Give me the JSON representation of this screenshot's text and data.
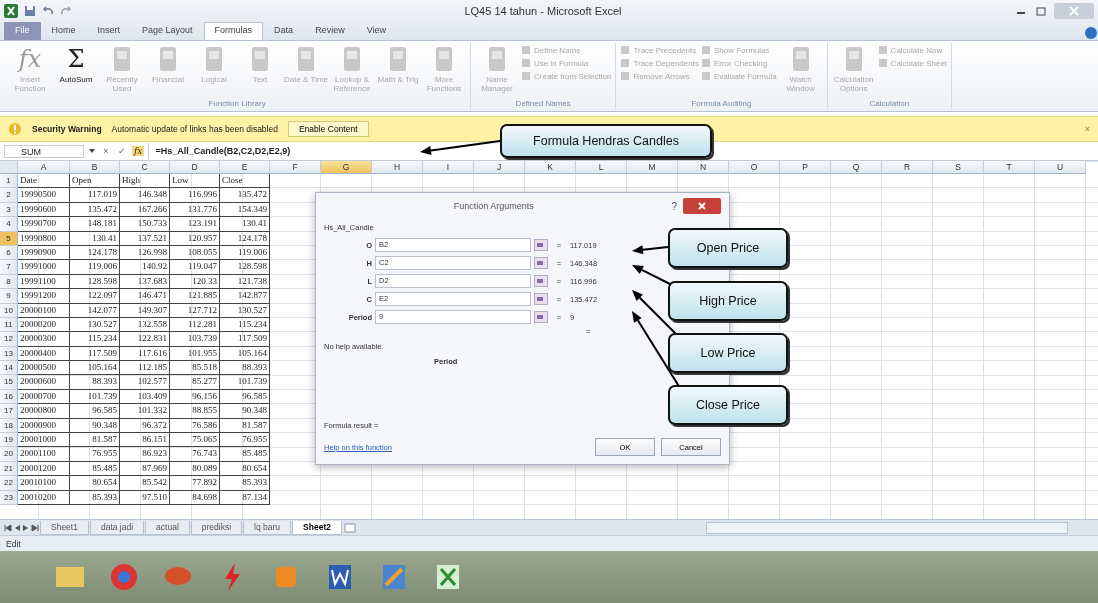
{
  "window": {
    "title": "LQ45 14 tahun - Microsoft Excel"
  },
  "ribbon_tabs": [
    {
      "label": "File",
      "selected": false,
      "kind": "file"
    },
    {
      "label": "Home",
      "selected": false,
      "kind": "tab"
    },
    {
      "label": "Insert",
      "selected": false,
      "kind": "tab"
    },
    {
      "label": "Page Layout",
      "selected": false,
      "kind": "tab"
    },
    {
      "label": "Formulas",
      "selected": true,
      "kind": "tab"
    },
    {
      "label": "Data",
      "selected": false,
      "kind": "tab"
    },
    {
      "label": "Review",
      "selected": false,
      "kind": "tab"
    },
    {
      "label": "View",
      "selected": false,
      "kind": "tab"
    }
  ],
  "ribbon_groups": [
    {
      "label": "Function Library",
      "buttons": [
        {
          "kind": "glyph",
          "glyph": "fx",
          "label": "Insert Function",
          "disabled": true
        },
        {
          "kind": "glyph",
          "glyph": "Σ",
          "label": "AutoSum",
          "disabled": false
        },
        {
          "kind": "large",
          "label": "Recently Used",
          "disabled": true
        },
        {
          "kind": "large",
          "label": "Financial",
          "disabled": true
        },
        {
          "kind": "large",
          "label": "Logical",
          "disabled": true
        },
        {
          "kind": "large",
          "label": "Text",
          "disabled": true
        },
        {
          "kind": "large",
          "label": "Date & Time",
          "disabled": true
        },
        {
          "kind": "large",
          "label": "Lookup & Reference",
          "disabled": true
        },
        {
          "kind": "large",
          "label": "Math & Trig",
          "disabled": true
        },
        {
          "kind": "large",
          "label": "More Functions",
          "disabled": true
        }
      ]
    },
    {
      "label": "Defined Names",
      "buttons": [
        {
          "kind": "large",
          "label": "Name Manager",
          "disabled": true
        },
        {
          "kind": "small",
          "label": "Define Name",
          "disabled": true
        },
        {
          "kind": "small",
          "label": "Use in Formula",
          "disabled": true
        },
        {
          "kind": "small",
          "label": "Create from Selection",
          "disabled": true
        }
      ]
    },
    {
      "label": "Formula Auditing",
      "buttons": [
        {
          "kind": "small",
          "label": "Trace Precedents",
          "disabled": true
        },
        {
          "kind": "small",
          "label": "Trace Dependents",
          "disabled": true
        },
        {
          "kind": "small",
          "label": "Remove Arrows",
          "disabled": true
        },
        {
          "kind": "small",
          "label": "Show Formulas",
          "disabled": true
        },
        {
          "kind": "small",
          "label": "Error Checking",
          "disabled": true
        },
        {
          "kind": "small",
          "label": "Evaluate Formula",
          "disabled": true
        },
        {
          "kind": "large",
          "label": "Watch Window",
          "disabled": true
        }
      ]
    },
    {
      "label": "Calculation",
      "buttons": [
        {
          "kind": "large",
          "label": "Calculation Options",
          "disabled": true
        },
        {
          "kind": "small",
          "label": "Calculate Now",
          "disabled": true
        },
        {
          "kind": "small",
          "label": "Calculate Sheet",
          "disabled": true
        }
      ]
    }
  ],
  "message_bar": {
    "title": "Security Warning",
    "message": "Automatic update of links has been disabled",
    "button": "Enable Content",
    "close": "×"
  },
  "formula_bar": {
    "name_box": "SUM",
    "cancel": "×",
    "enter": "✓",
    "function": "fx",
    "formula": "=Hs_All_Candle(B2,C2,D2,E2,9)"
  },
  "columns": [
    {
      "label": "A",
      "selected": false
    },
    {
      "label": "B",
      "selected": false
    },
    {
      "label": "C",
      "selected": false
    },
    {
      "label": "D",
      "selected": false
    },
    {
      "label": "E",
      "selected": false
    },
    {
      "label": "F",
      "selected": false
    },
    {
      "label": "G",
      "selected": true
    },
    {
      "label": "H",
      "selected": false
    },
    {
      "label": "I",
      "selected": false
    },
    {
      "label": "J",
      "selected": false
    },
    {
      "label": "K",
      "selected": false
    },
    {
      "label": "L",
      "selected": false
    },
    {
      "label": "M",
      "selected": false
    },
    {
      "label": "N",
      "selected": false
    },
    {
      "label": "O",
      "selected": false
    },
    {
      "label": "P",
      "selected": false
    },
    {
      "label": "Q",
      "selected": false
    },
    {
      "label": "R",
      "selected": false
    },
    {
      "label": "S",
      "selected": false
    },
    {
      "label": "T",
      "selected": false
    },
    {
      "label": "U",
      "selected": false
    }
  ],
  "rows": [
    {
      "header": "1",
      "selected": false,
      "cells": [
        "Date",
        "Open",
        "High",
        "Low",
        "Close"
      ]
    },
    {
      "header": "2",
      "selected": false,
      "cells": [
        "19990500",
        "117.019",
        "146.348",
        "116.996",
        "135.472"
      ]
    },
    {
      "header": "3",
      "selected": false,
      "cells": [
        "19990600",
        "135.472",
        "167.266",
        "131.776",
        "154.349"
      ]
    },
    {
      "header": "4",
      "selected": false,
      "cells": [
        "19990700",
        "148.181",
        "150.733",
        "123.191",
        "130.41"
      ]
    },
    {
      "header": "5",
      "selected": true,
      "cells": [
        "19990800",
        "130.41",
        "137.521",
        "120.957",
        "124.178"
      ]
    },
    {
      "header": "6",
      "selected": false,
      "cells": [
        "19990900",
        "124.178",
        "126.998",
        "108.055",
        "119.006"
      ]
    },
    {
      "header": "7",
      "selected": false,
      "cells": [
        "19991000",
        "119.006",
        "140.92",
        "119.047",
        "128.598"
      ]
    },
    {
      "header": "8",
      "selected": false,
      "cells": [
        "19991100",
        "128.598",
        "137.683",
        "120.33",
        "121.738"
      ]
    },
    {
      "header": "9",
      "selected": false,
      "cells": [
        "19991200",
        "122.097",
        "146.471",
        "121.885",
        "142.877"
      ]
    },
    {
      "header": "10",
      "selected": false,
      "cells": [
        "20000100",
        "142.077",
        "149.307",
        "127.712",
        "130.527"
      ]
    },
    {
      "header": "11",
      "selected": false,
      "cells": [
        "20000200",
        "130.527",
        "132.558",
        "112.281",
        "115.234"
      ]
    },
    {
      "header": "12",
      "selected": false,
      "cells": [
        "20000300",
        "115.234",
        "122.831",
        "103.739",
        "117.509"
      ]
    },
    {
      "header": "13",
      "selected": false,
      "cells": [
        "20000400",
        "117.509",
        "117.616",
        "101.955",
        "105.164"
      ]
    },
    {
      "header": "14",
      "selected": false,
      "cells": [
        "20000500",
        "105.164",
        "112.185",
        "85.518",
        "88.393"
      ]
    },
    {
      "header": "15",
      "selected": false,
      "cells": [
        "20000600",
        "88.393",
        "102.577",
        "85.277",
        "101.739"
      ]
    },
    {
      "header": "16",
      "selected": false,
      "cells": [
        "20000700",
        "101.739",
        "103.409",
        "96.156",
        "96.585"
      ]
    },
    {
      "header": "17",
      "selected": false,
      "cells": [
        "20000800",
        "96.585",
        "101.332",
        "88.855",
        "90.348"
      ]
    },
    {
      "header": "18",
      "selected": false,
      "cells": [
        "20000900",
        "90.348",
        "96.372",
        "76.586",
        "81.587"
      ]
    },
    {
      "header": "19",
      "selected": false,
      "cells": [
        "20001000",
        "81.587",
        "86.151",
        "75.065",
        "76.955"
      ]
    },
    {
      "header": "20",
      "selected": false,
      "cells": [
        "20001100",
        "76.955",
        "86.923",
        "76.743",
        "85.485"
      ]
    },
    {
      "header": "21",
      "selected": false,
      "cells": [
        "20001200",
        "85.485",
        "87.969",
        "80.089",
        "80.654"
      ]
    },
    {
      "header": "22",
      "selected": false,
      "cells": [
        "20010100",
        "80.654",
        "85.542",
        "77.892",
        "85.393"
      ]
    },
    {
      "header": "23",
      "selected": false,
      "cells": [
        "20010200",
        "85.393",
        "97.510",
        "84.698",
        "87.134"
      ]
    }
  ],
  "sheet_tabs": [
    {
      "label": "Sheet1",
      "selected": false
    },
    {
      "label": "data jadi",
      "selected": false
    },
    {
      "label": "actual",
      "selected": false
    },
    {
      "label": "prediksi",
      "selected": false
    },
    {
      "label": "lq baru",
      "selected": false
    },
    {
      "label": "Sheet2",
      "selected": true
    }
  ],
  "status_bar": {
    "mode": "Edit"
  },
  "dialog": {
    "title": "Function Arguments",
    "help": "?",
    "function_name": "Hs_All_Candle",
    "arguments": [
      {
        "label": "O",
        "value": "B2",
        "equals": "=",
        "result": "117.019"
      },
      {
        "label": "H",
        "value": "C2",
        "equals": "=",
        "result": "146.348"
      },
      {
        "label": "L",
        "value": "D2",
        "equals": "=",
        "result": "116.996"
      },
      {
        "label": "C",
        "value": "E2",
        "equals": "=",
        "result": "135.472"
      },
      {
        "label": "Period",
        "value": "9",
        "equals": "=",
        "result": "9"
      }
    ],
    "total_equals": "=",
    "help_text": "No help available.",
    "current_argument": "Period",
    "formula_result": "Formula result =",
    "help_link": "Help on this function",
    "ok": "OK",
    "cancel": "Cancel"
  },
  "callouts": [
    {
      "text": "Formula Hendras  Candles",
      "kind": "formula"
    },
    {
      "text": "Open Price",
      "kind": "open"
    },
    {
      "text": "High Price",
      "kind": "high"
    },
    {
      "text": "Low Price",
      "kind": "low"
    },
    {
      "text": "Close Price",
      "kind": "close"
    }
  ]
}
